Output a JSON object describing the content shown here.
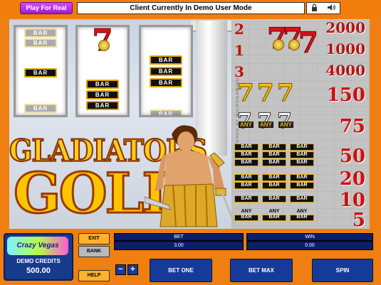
{
  "header": {
    "play_for_real": "Play For Real",
    "mode_message": "Client Currently In Demo User Mode",
    "lock_icon": "lock-icon",
    "sound_icon": "speaker-icon"
  },
  "reels": {
    "reel1": [
      "BAR",
      "BAR",
      "BAR",
      "BAR"
    ],
    "reel2_seven": "7",
    "reel2_bars": [
      "BAR",
      "BAR",
      "BAR"
    ],
    "reel3": [
      "BAR",
      "BAR",
      "BAR",
      "BAR"
    ]
  },
  "logo": {
    "line1": "GLADIATORS",
    "line2": "GOLD"
  },
  "powered_by": "POWERED BY MICROGAMING",
  "paytable": {
    "rows": [
      {
        "index": "2",
        "payout": "2000"
      },
      {
        "index": "1",
        "payout": "1000"
      },
      {
        "index": "3",
        "payout": "4000"
      },
      {
        "symbol": "777",
        "payout": "150"
      },
      {
        "symbol": "ANY 7",
        "any_label": "ANY",
        "payout": "75"
      },
      {
        "symbol": "BAR BAR BAR",
        "payout": "50"
      },
      {
        "symbol": "BAR BAR",
        "payout": "20"
      },
      {
        "symbol": "BAR",
        "payout": "10"
      },
      {
        "symbol": "ANY BAR",
        "any_label": "ANY",
        "bar_label": "BAR",
        "payout": "5"
      }
    ],
    "seven": "7",
    "bar": "BAR"
  },
  "controls": {
    "brand": "Crazy Vegas",
    "credits_label": "DEMO CREDITS",
    "credits_value": "500.00",
    "exit": "EXIT",
    "bank": "BANK",
    "help": "HELP",
    "bet_label": "BET",
    "bet_value": "3.00",
    "win_label": "WIN",
    "win_value": "0.00",
    "minus": "−",
    "plus": "+",
    "bet_one": "BET ONE",
    "bet_max": "BET MAX",
    "spin": "SPIN"
  },
  "colors": {
    "frame_orange": "#ef7f10",
    "panel_blue": "#163a9a",
    "play_real_purple": "#b536e6",
    "seven_red": "#d8121b",
    "gold": "#ffc400"
  }
}
